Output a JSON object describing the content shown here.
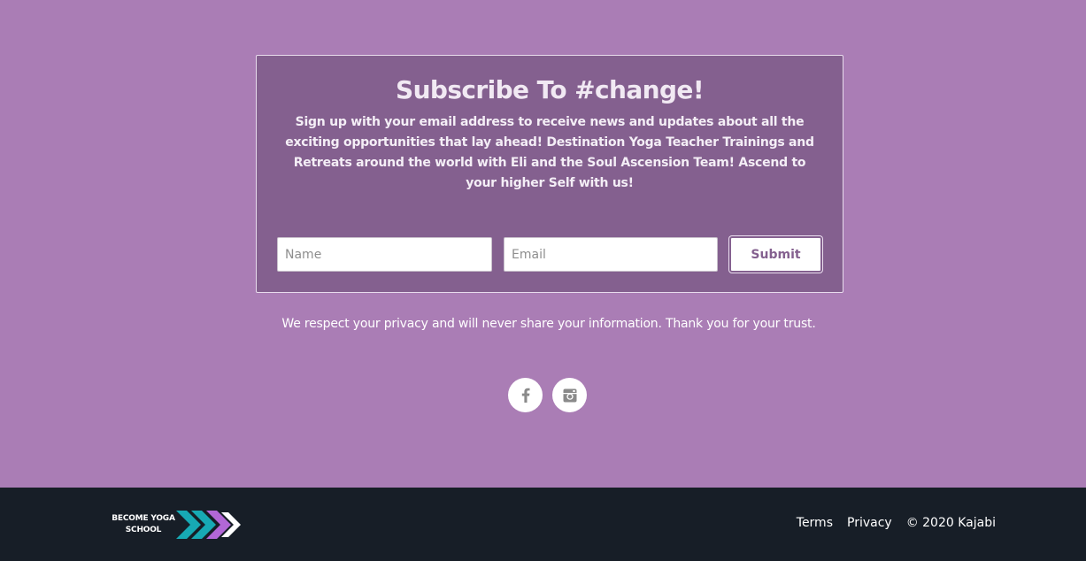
{
  "subscribe": {
    "title": "Subscribe To #change!",
    "description": "Sign up with your email address to receive news and updates about all the exciting opportunities that lay ahead! Destination Yoga Teacher Trainings and Retreats around the world with Eli and the Soul Ascension Team! Ascend to your higher Self with us!",
    "name_placeholder": "Name",
    "email_placeholder": "Email",
    "name_value": "",
    "email_value": "",
    "submit_label": "Submit"
  },
  "privacy_text": "We respect your privacy and will never share your information. Thank you for your trust.",
  "social": [
    {
      "icon": "facebook-icon"
    },
    {
      "icon": "instagram-icon"
    }
  ],
  "footer": {
    "logo_line1": "BECOME YOGA",
    "logo_line2": "SCHOOL",
    "links": [
      "Terms",
      "Privacy"
    ],
    "copyright": "© 2020 Kajabi"
  },
  "colors": {
    "page_bg": "#aa7db5",
    "card_bg": "#84608f",
    "footer_bg": "#171e27",
    "logo_teal": "#17a9b4",
    "logo_purple": "#b267d6"
  }
}
